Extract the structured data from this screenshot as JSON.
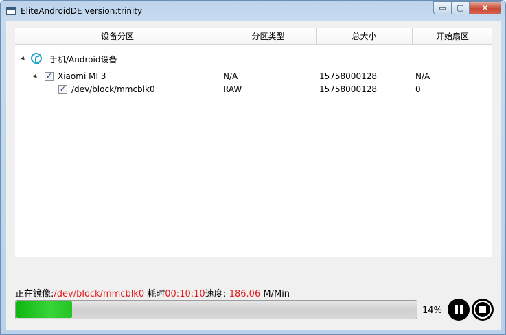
{
  "window": {
    "title": "EliteAndroidDE version:trinity",
    "minimize_glyph": "▭",
    "maximize_glyph": "▢",
    "close_glyph": "✕"
  },
  "table": {
    "columns": [
      "设备分区",
      "分区类型",
      "总大小",
      "开始扇区"
    ],
    "root": {
      "label": "手机/Android设备",
      "icon": "phone-icon"
    },
    "device": {
      "name": "Xiaomi MI 3",
      "checked": true,
      "type": "N/A",
      "size": "15758000128",
      "start": "N/A"
    },
    "partition": {
      "name": "/dev/block/mmcblk0",
      "checked": true,
      "type": "RAW",
      "size": "15758000128",
      "start": "0"
    }
  },
  "status": {
    "mirroring_label": "正在镜像:",
    "mirroring_path": "/dev/block/mmcblk0",
    "elapsed_label": "耗时",
    "elapsed_value": "00:10:10",
    "speed_label": "速度:",
    "speed_value": "-186.06",
    "speed_unit": "M/Min"
  },
  "progress": {
    "fraction": 0.14,
    "label": "14%",
    "color": "#24c424"
  },
  "controls": {
    "pause_icon": "pause-icon",
    "stop_icon": "stop-icon"
  },
  "checkbox_glyph": "✓"
}
